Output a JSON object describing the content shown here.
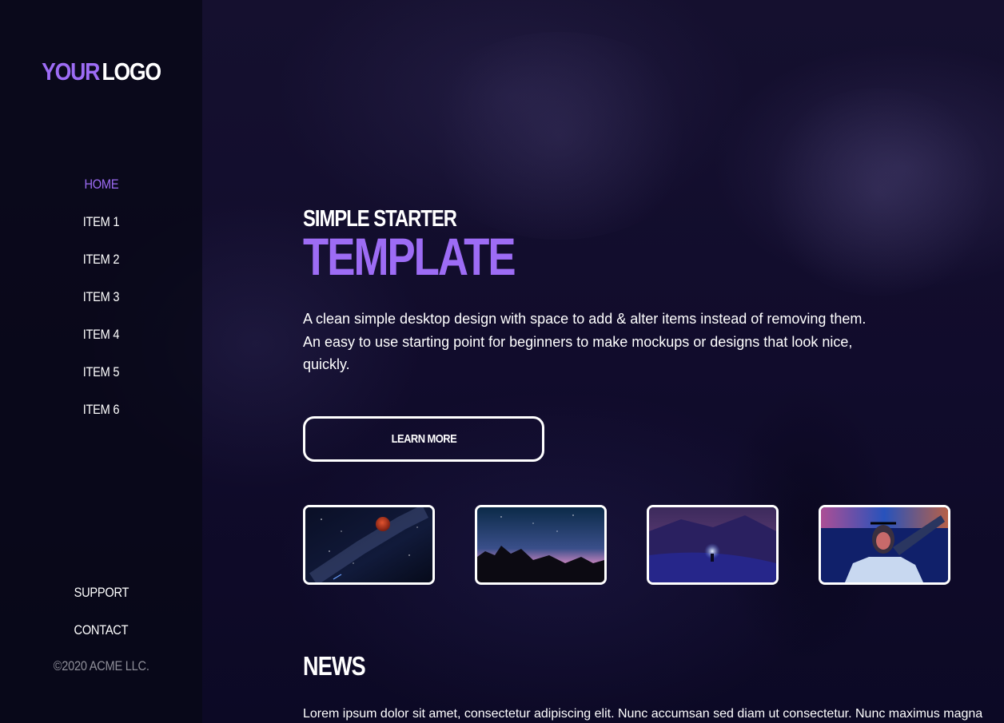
{
  "logo": {
    "part1": "YOUR",
    "part2": "LOGO"
  },
  "nav": {
    "items": [
      "HOME",
      "ITEM 1",
      "ITEM 2",
      "ITEM 3",
      "ITEM 4",
      "ITEM 5",
      "ITEM 6"
    ],
    "active": "HOME"
  },
  "footer_nav": {
    "support": "SUPPORT",
    "contact": "CONTACT"
  },
  "copyright": "©2020 ACME LLC.",
  "hero": {
    "subtitle": "SIMPLE STARTER",
    "title": "TEMPLATE",
    "text": "A clean simple desktop design with space to add & alter items instead of removing them. An easy to use starting point for beginners to make mockups or designs that look nice, quickly.",
    "cta_label": "LEARN MORE"
  },
  "thumbnails": [
    "red-moon-night-sky",
    "starry-sky-over-rocks",
    "light-orb-in-snow",
    "neon-portrait"
  ],
  "news": {
    "title": "NEWS",
    "text": "Lorem ipsum dolor sit amet, consectetur adipiscing elit. Nunc accumsan sed diam ut consectetur. Nunc maximus magna"
  },
  "colors": {
    "accent": "#9d6cf5",
    "background": "#110c2c",
    "sidebar": "#08081a",
    "text": "#ffffff",
    "muted": "#8e8e98"
  }
}
